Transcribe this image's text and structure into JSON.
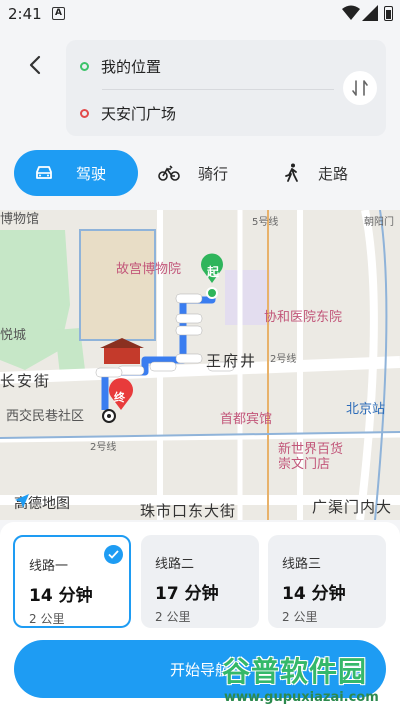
{
  "status_bar": {
    "time": "2:41",
    "notification_glyph": "A"
  },
  "header": {
    "from": "我的位置",
    "to": "天安门广场"
  },
  "modes": [
    {
      "label": "驾驶",
      "icon": "car-icon",
      "selected": true
    },
    {
      "label": "骑行",
      "icon": "bike-icon",
      "selected": false
    },
    {
      "label": "走路",
      "icon": "walk-icon",
      "selected": false
    }
  ],
  "map": {
    "labels": {
      "palace": "故宫博物院",
      "museum": "博物馆",
      "hospital": "协和医院东院",
      "wangfujing": "王府井",
      "changan": "长安街",
      "xijiao": "西交民巷社区",
      "hotel": "首都宾馆",
      "beijing_station": "北京站",
      "mall": "新世界百货\n崇文门店",
      "chongwen": "珠市口东大街",
      "guangqu": "广渠门内大",
      "yueyue": "悦城",
      "chaoyangmen": "朝阳门",
      "line5": "5号线",
      "line2a": "2号线",
      "line2b": "2号线"
    },
    "markers": {
      "start": "起",
      "end": "终"
    },
    "logo_text": "高德地图"
  },
  "routes": [
    {
      "name": "线路一",
      "time": "14 分钟",
      "distance": "2 公里",
      "selected": true
    },
    {
      "name": "线路二",
      "time": "17 分钟",
      "distance": "2 公里",
      "selected": false
    },
    {
      "name": "线路三",
      "time": "14 分钟",
      "distance": "2 公里",
      "selected": false
    }
  ],
  "start_button": "开始导航",
  "watermark": {
    "title": "谷普软件园",
    "url": "www.gupuxiazai.com"
  },
  "colors": {
    "accent": "#1e9cf3",
    "start_marker": "#2fb55b",
    "end_marker": "#e83b3b",
    "route": "#3a7df0"
  }
}
